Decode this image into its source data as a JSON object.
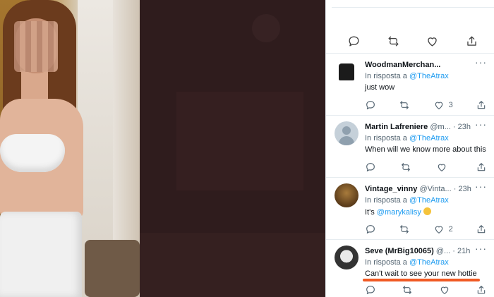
{
  "media": {
    "description_icon": "photo"
  },
  "top_actions": [
    {
      "icon": "reply-icon"
    },
    {
      "icon": "retweet-icon"
    },
    {
      "icon": "like-icon"
    },
    {
      "icon": "share-icon"
    }
  ],
  "replies": [
    {
      "name": "WoodmanMerchan...",
      "handle": "",
      "time": "",
      "in_reply_prefix": "In risposta a",
      "in_reply_mention": "@TheAtrax",
      "text": "just wow",
      "mention": "",
      "likes": "3",
      "avatar": "shirt"
    },
    {
      "name": "Martin Lafreniere",
      "handle": "@m...",
      "time": "· 23h",
      "in_reply_prefix": "In risposta a",
      "in_reply_mention": "@TheAtrax",
      "text": "When will we know more about this",
      "mention": "",
      "likes": "",
      "avatar": "default"
    },
    {
      "name": "Vintage_vinny",
      "handle": "@Vinta...",
      "time": "· 23h",
      "in_reply_prefix": "In risposta a",
      "in_reply_mention": "@TheAtrax",
      "text_prefix": "It's",
      "mention": "@marykalisy",
      "likes": "2",
      "avatar": "vintage"
    },
    {
      "name": "Seve (MrBig10065)",
      "handle": "@...",
      "time": "· 21h",
      "in_reply_prefix": "In risposta a",
      "in_reply_mention": "@TheAtrax",
      "text": "Can't wait to see your new hottie",
      "mention": "",
      "likes": "",
      "avatar": "seve"
    }
  ],
  "more_label": "···",
  "colors": {
    "link": "#1d9bf0",
    "underline": "#f05a24"
  }
}
